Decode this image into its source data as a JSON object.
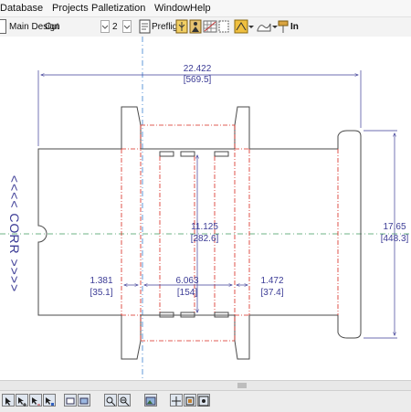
{
  "menu": [
    "Database",
    "Projects",
    "Palletization",
    "Window",
    "Help"
  ],
  "toolbar": {
    "design_label": "Main Design",
    "view_value": "Cut",
    "count_value": "2",
    "preflight_label": "Preflight",
    "units_label": "In"
  },
  "drawing": {
    "dims": {
      "overall_width": "22.422",
      "overall_width_mm": "[569.5]",
      "center_height": "11.125",
      "center_height_mm": "[282.6]",
      "overall_height": "17.65",
      "overall_height_mm": "[448.3]",
      "left_panel": "1.381",
      "left_panel_mm": "[35.1]",
      "middle_panel": "6.063",
      "middle_panel_mm": "[154]",
      "right_panel": "1.472",
      "right_panel_mm": "[37.4]"
    },
    "flute_direction": "<<<< CORR >>>>"
  },
  "colors": {
    "cut": "#4a4a4a",
    "crease": "#d8281e",
    "dimension": "#3c3c96",
    "axis": "#3a7fd0",
    "centerline": "#3d9a5c"
  },
  "icons": {
    "toolbar": [
      "design-icon",
      "dropdown-icon",
      "spin-icon",
      "preflight-icon",
      "book-icon",
      "figure-icon",
      "grid-icon",
      "page-icon",
      "database-icon",
      "palette-icon",
      "shape-icon",
      "pin-icon"
    ],
    "bottom": [
      "select-icon",
      "select-plus-icon",
      "select-arrow-icon",
      "select-move-icon",
      "view-icon",
      "view-alt-icon",
      "zoom-in-icon",
      "zoom-out-icon",
      "image-icon",
      "move-icon",
      "fit-icon",
      "zoom-extent-icon"
    ]
  }
}
